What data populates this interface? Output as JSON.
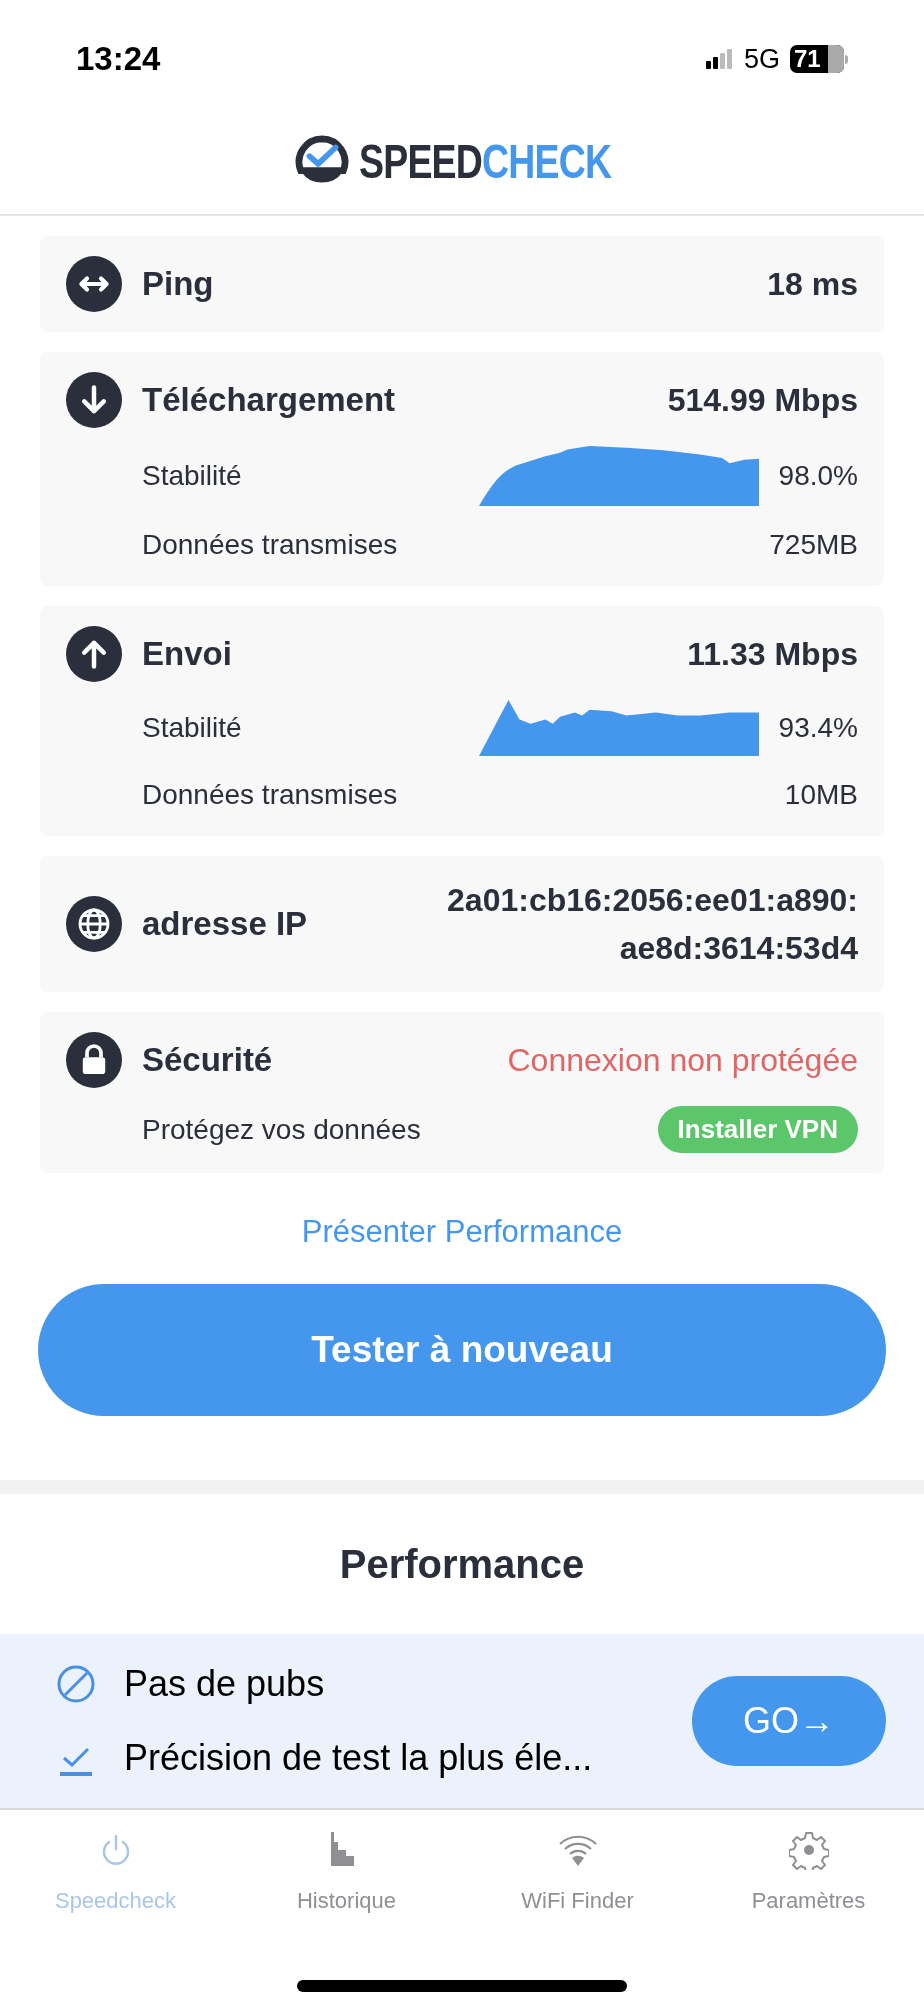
{
  "status_bar": {
    "time": "13:24",
    "network": "5G",
    "battery": "71"
  },
  "logo": [
    "SPEED",
    "CHECK"
  ],
  "cards": [
    {
      "kind": "ping",
      "title": "Ping",
      "value": "18 ms",
      "alert": false
    },
    {
      "kind": "download",
      "title": "Téléchargement",
      "value": "514.99 Mbps",
      "alert": false,
      "rows": [
        {
          "kind": "sparkline",
          "label": "Stabilité",
          "value": "98.0%"
        },
        {
          "kind": "text",
          "label": "Données transmises",
          "value": "725MB"
        }
      ]
    },
    {
      "kind": "upload",
      "title": "Envoi",
      "value": "11.33 Mbps",
      "alert": false,
      "rows": [
        {
          "kind": "sparkline",
          "label": "Stabilité",
          "value": "93.4%"
        },
        {
          "kind": "text",
          "label": "Données transmises",
          "value": "10MB"
        }
      ]
    },
    {
      "kind": "ip",
      "title": "adresse IP",
      "value": "2a01:cb16:2056:ee01:a890:\nae8d:3614:53d4",
      "alert": false
    },
    {
      "kind": "security",
      "title": "Sécurité",
      "value": "Connexion non protégée",
      "alert": true,
      "rows": [
        {
          "kind": "button",
          "label": "Protégez vos données",
          "value": "Installer VPN"
        }
      ]
    }
  ],
  "show_performance_link": "Présenter Performance",
  "retest_button": "Tester à nouveau",
  "performance_heading": "Performance",
  "promo": {
    "features": [
      "Pas de pubs",
      "Précision de test la plus éle..."
    ],
    "button": "GO→"
  },
  "tabs": [
    {
      "label": "Speedcheck",
      "selected": true
    },
    {
      "label": "Historique",
      "selected": false
    },
    {
      "label": "WiFi Finder",
      "selected": false
    },
    {
      "label": "Paramètres",
      "selected": false
    }
  ]
}
